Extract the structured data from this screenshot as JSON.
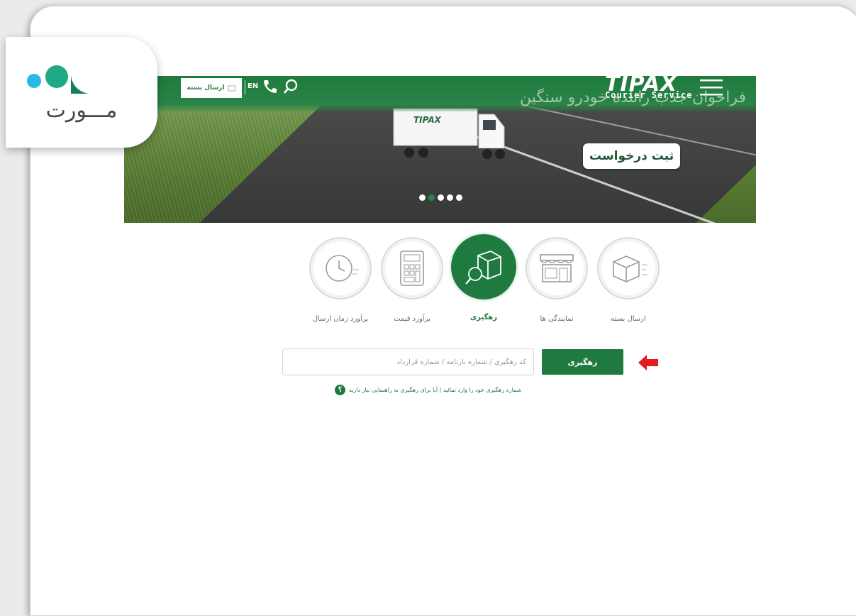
{
  "logo": {
    "text": "مـــورت"
  },
  "header": {
    "send_button_label": "ارسال بسته",
    "language_label": "EN",
    "brand_name": "TIPAX",
    "brand_tagline": "Courier Service"
  },
  "banner": {
    "title": "فراخوان جذب راننده خودرو سنگین",
    "cta_label": "ثبت درخواست",
    "truck_text": "TIPAX",
    "slides": [
      {
        "active": false
      },
      {
        "active": true
      },
      {
        "active": false
      },
      {
        "active": false
      },
      {
        "active": false
      }
    ]
  },
  "services": [
    {
      "label": "برآورد زمان ارسال",
      "icon": "clock-icon"
    },
    {
      "label": "برآورد قیمت",
      "icon": "calculator-icon"
    },
    {
      "label": "رهگیری",
      "icon": "package-search-icon",
      "active": true
    },
    {
      "label": "نمایندگی ها",
      "icon": "storefront-icon"
    },
    {
      "label": "ارسال بسته",
      "icon": "box-icon"
    }
  ],
  "tracking": {
    "placeholder": "کد رهگیری / شماره بارنامه / شماره قرارداد",
    "button_label": "رهگیری",
    "hint": "شماره رهگیری خود را وارد نمائید | آیا برای رهگیری به راهنمایی نیاز دارید",
    "help_symbol": "؟"
  },
  "colors": {
    "brand_green": "#1e7a3f",
    "arrow_red": "#e31b23"
  }
}
